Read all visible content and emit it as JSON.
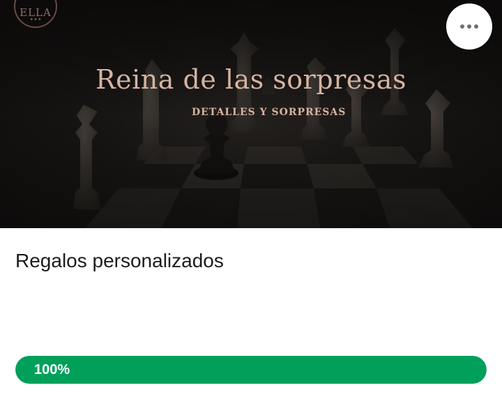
{
  "banner": {
    "logo_text": "ELLA",
    "title": "Reina de las sorpresas",
    "subtitle": "DETALLES Y SORPRESAS",
    "colors": {
      "title": "#d6b3a2",
      "background": "#161412"
    }
  },
  "actions": {
    "more_icon": "more-horizontal-icon"
  },
  "product": {
    "title": "Regalos personalizados"
  },
  "progress": {
    "value": 100,
    "label": "100%",
    "color": "#00a05a"
  }
}
